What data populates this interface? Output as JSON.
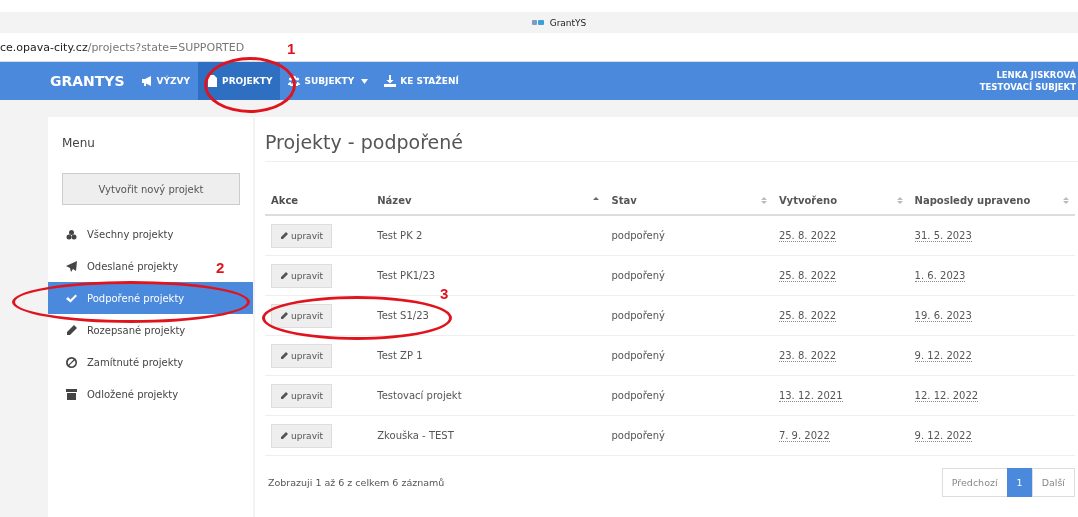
{
  "browser": {
    "tab_title": "GrantYS",
    "url_host": "ce.opava-city.cz",
    "url_path": "/projects?state=SUPPORTED"
  },
  "navbar": {
    "brand": "GRANTYS",
    "items": [
      {
        "label": "VÝZVY",
        "selected": false,
        "dropdown": false
      },
      {
        "label": "PROJEKTY",
        "selected": true,
        "dropdown": false
      },
      {
        "label": "SUBJEKTY",
        "selected": false,
        "dropdown": true
      },
      {
        "label": "KE STAŽENÍ",
        "selected": false,
        "dropdown": false
      }
    ],
    "user": {
      "name": "LENKA JISKROVÁ",
      "subject": "TESTOVACÍ SUBJEKT"
    }
  },
  "sidebar": {
    "title": "Menu",
    "create_button": "Vytvořit nový projekt",
    "items": [
      {
        "label": "Všechny projekty",
        "selected": false
      },
      {
        "label": "Odeslané projekty",
        "selected": false
      },
      {
        "label": "Podpořené projekty",
        "selected": true
      },
      {
        "label": "Rozepsané projekty",
        "selected": false
      },
      {
        "label": "Zamítnuté projekty",
        "selected": false
      },
      {
        "label": "Odložené projekty",
        "selected": false
      }
    ]
  },
  "page_title": "Projekty - podpořené",
  "table": {
    "columns": [
      {
        "label": "Akce",
        "sortable": false,
        "sorted": false
      },
      {
        "label": "Název",
        "sortable": true,
        "sorted": true
      },
      {
        "label": "Stav",
        "sortable": true,
        "sorted": false
      },
      {
        "label": "Vytvořeno",
        "sortable": true,
        "sorted": false
      },
      {
        "label": "Naposledy upraveno",
        "sortable": true,
        "sorted": false
      }
    ],
    "rows": [
      {
        "action": "upravit",
        "name": "Test PK 2",
        "state": "podpořený",
        "created": "25. 8. 2022",
        "modified": "31. 5. 2023"
      },
      {
        "action": "upravit",
        "name": "Test PK1/23",
        "state": "podpořený",
        "created": "25. 8. 2022",
        "modified": "1. 6. 2023"
      },
      {
        "action": "upravit",
        "name": "Test S1/23",
        "state": "podpořený",
        "created": "25. 8. 2022",
        "modified": "19. 6. 2023"
      },
      {
        "action": "upravit",
        "name": "Test ZP 1",
        "state": "podpořený",
        "created": "23. 8. 2022",
        "modified": "9. 12. 2022"
      },
      {
        "action": "upravit",
        "name": "Testovací projekt",
        "state": "podpořený",
        "created": "13. 12. 2021",
        "modified": "12. 12. 2022"
      },
      {
        "action": "upravit",
        "name": "Zkouška - TEST",
        "state": "podpořený",
        "created": "7. 9. 2022",
        "modified": "9. 12. 2022"
      }
    ]
  },
  "info": "Zobrazuji 1 až 6 z celkem 6 záznamů",
  "pagination": [
    {
      "label": "Předchozí",
      "selected": false
    },
    {
      "label": "1",
      "selected": true
    },
    {
      "label": "Další",
      "selected": false
    }
  ],
  "annotations": [
    {
      "label": "1"
    },
    {
      "label": "2"
    },
    {
      "label": "3"
    }
  ]
}
